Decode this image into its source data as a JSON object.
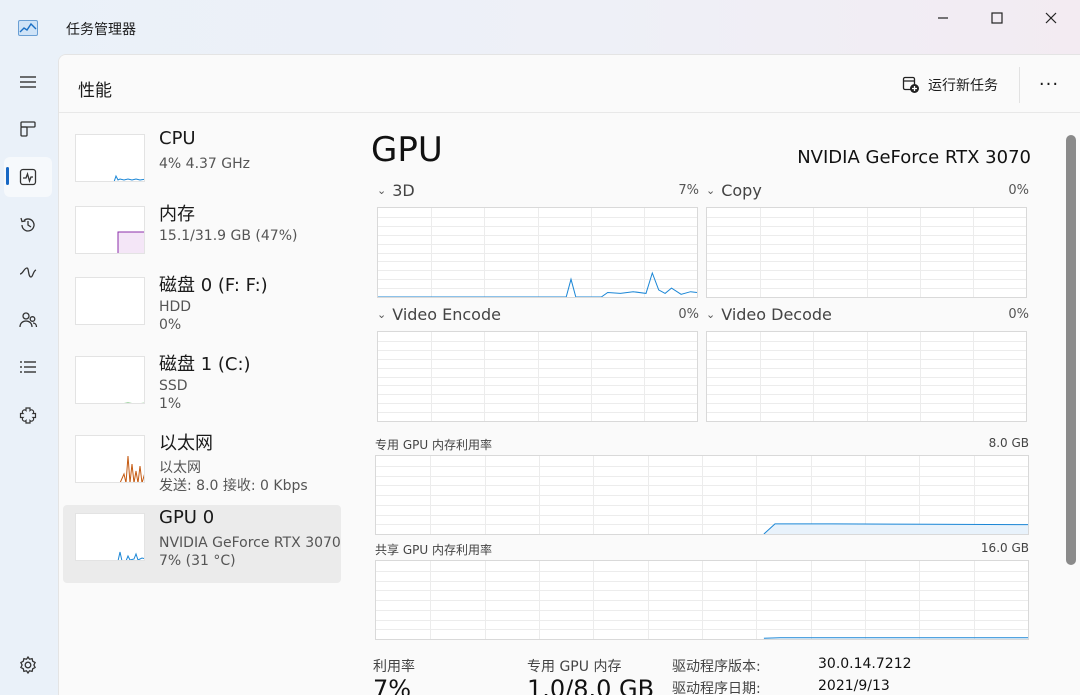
{
  "window": {
    "title": "任务管理器",
    "icon": "chart-window-icon"
  },
  "nav": {
    "items": [
      {
        "name": "hamburger-icon"
      },
      {
        "name": "processes-icon"
      },
      {
        "name": "performance-icon",
        "active": true
      },
      {
        "name": "app-history-icon"
      },
      {
        "name": "startup-apps-icon"
      },
      {
        "name": "users-icon"
      },
      {
        "name": "details-icon"
      },
      {
        "name": "services-icon"
      },
      {
        "name": "settings-icon"
      }
    ]
  },
  "header": {
    "title": "性能",
    "run_task": "运行新任务",
    "more": "···"
  },
  "devices": [
    {
      "name": "CPU",
      "line1": "4% 4.37 GHz",
      "line2": "",
      "color": "#1a86d6"
    },
    {
      "name": "内存",
      "line1": "15.1/31.9 GB (47%)",
      "line2": "",
      "color": "#8b2fa9"
    },
    {
      "name": "磁盘 0 (F: F:)",
      "line1": "HDD",
      "line2": "0%",
      "color": "#4caf50"
    },
    {
      "name": "磁盘 1 (C:)",
      "line1": "SSD",
      "line2": "1%",
      "color": "#4caf50"
    },
    {
      "name": "以太网",
      "line1": "以太网",
      "line2": "发送: 8.0 接收: 0 Kbps",
      "color": "#c55a11"
    },
    {
      "name": "GPU 0",
      "line1": "NVIDIA GeForce RTX 3070",
      "line2": "7% (31 °C)",
      "color": "#1a86d6",
      "selected": true
    }
  ],
  "gpu": {
    "title": "GPU",
    "model": "NVIDIA GeForce RTX 3070",
    "engines": [
      {
        "label": "3D",
        "pct": "7%"
      },
      {
        "label": "Copy",
        "pct": "0%"
      },
      {
        "label": "Video Encode",
        "pct": "0%"
      },
      {
        "label": "Video Decode",
        "pct": "0%"
      }
    ],
    "dedicated_mem": {
      "label": "专用 GPU 内存利用率",
      "max": "8.0 GB"
    },
    "shared_mem": {
      "label": "共享 GPU 内存利用率",
      "max": "16.0 GB"
    },
    "stats": [
      {
        "label": "利用率",
        "value": "7%"
      },
      {
        "label": "专用 GPU 内存",
        "value": "1.0/8.0 GB"
      }
    ],
    "info": [
      {
        "label": "驱动程序版本:",
        "value": "30.0.14.7212"
      },
      {
        "label": "驱动程序日期:",
        "value": "2021/9/13"
      }
    ],
    "accent": "#1a86d6"
  }
}
